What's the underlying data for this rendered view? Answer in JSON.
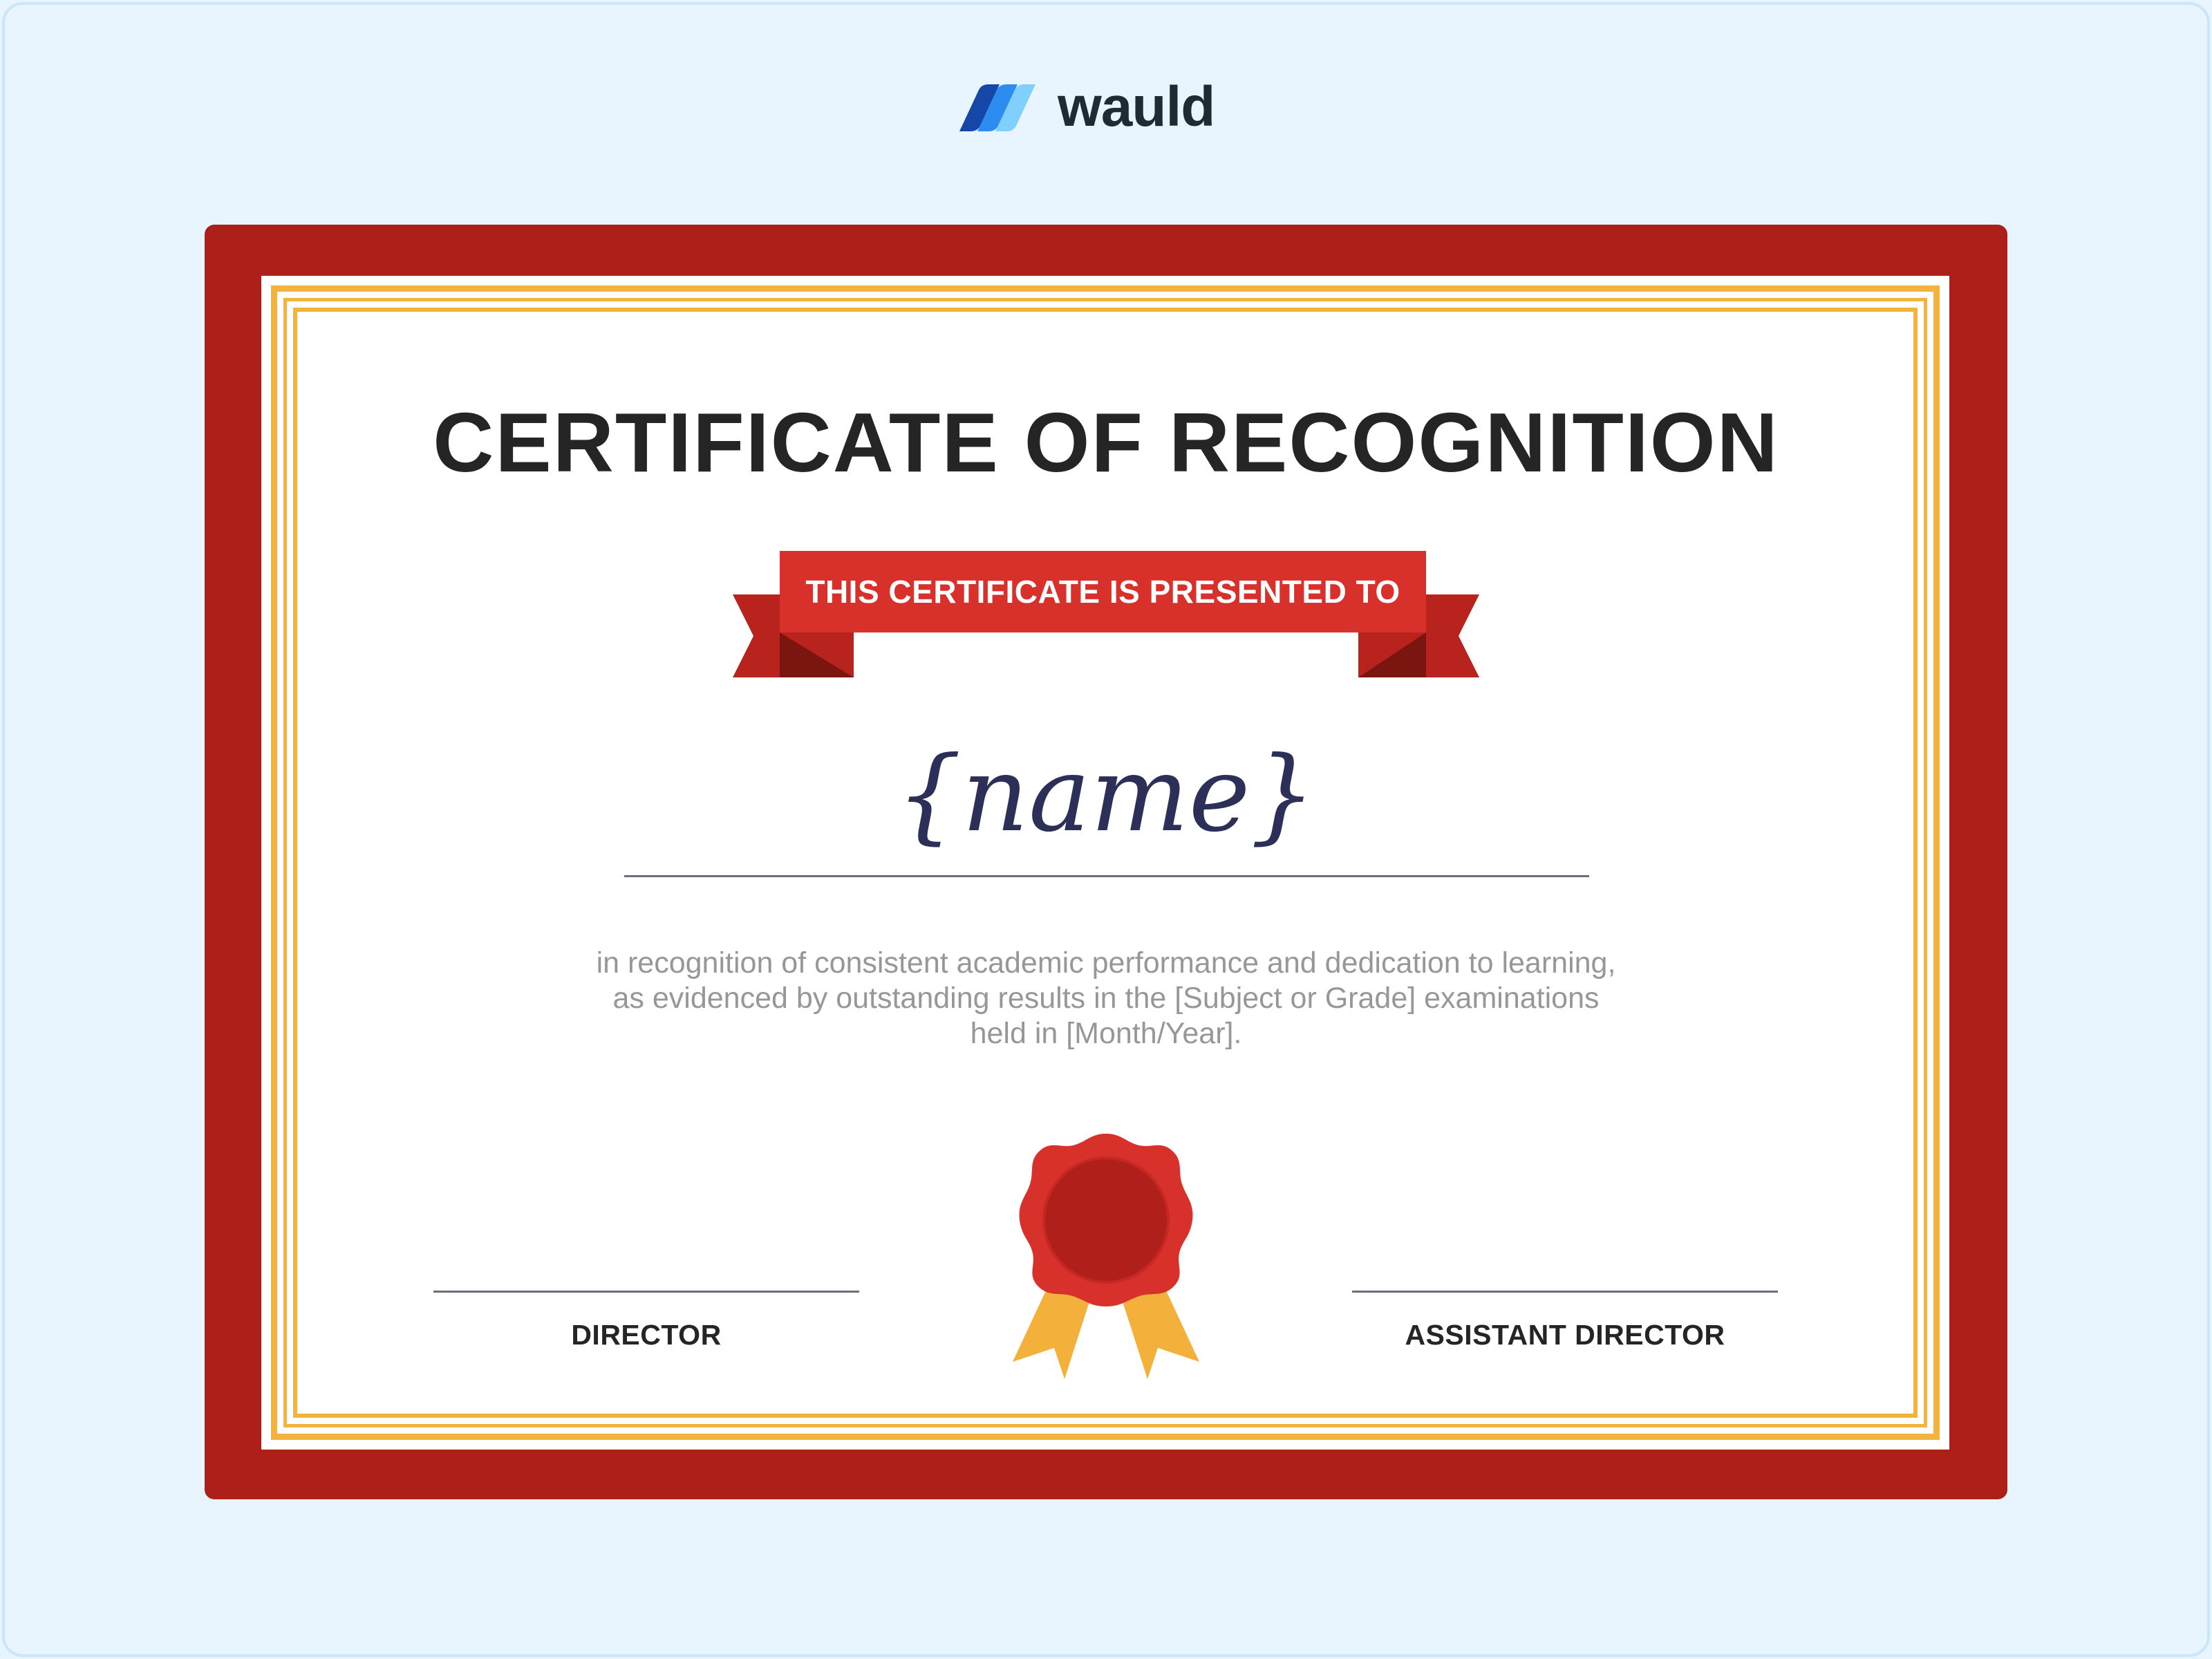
{
  "brand": {
    "name": "wauld",
    "logo_icon": "wauld-stripes-logo"
  },
  "certificate": {
    "title": "CERTIFICATE OF RECOGNITION",
    "ribbon_text": "THIS CERTIFICATE IS PRESENTED TO",
    "recipient_placeholder": "{name}",
    "body_lines": [
      "in recognition of consistent academic performance and dedication to learning,",
      "as evidenced by outstanding results in the [Subject or Grade] examinations",
      "held in [Month/Year]."
    ],
    "signatures": {
      "left_label": "DIRECTOR",
      "right_label": "ASSISTANT DIRECTOR"
    },
    "seal_icon": "award-seal-icon"
  },
  "colors": {
    "background": "#e8f5fe",
    "frame_red": "#ad1f19",
    "gold": "#f2b43f",
    "ribbon_red": "#d8302a",
    "ribbon_dark": "#b8231d",
    "name_ink": "#2c2f58",
    "body_text": "#979797",
    "brand_blue_dark": "#1447a8",
    "brand_blue": "#2d8cf0",
    "brand_blue_light": "#7fd0ff"
  }
}
